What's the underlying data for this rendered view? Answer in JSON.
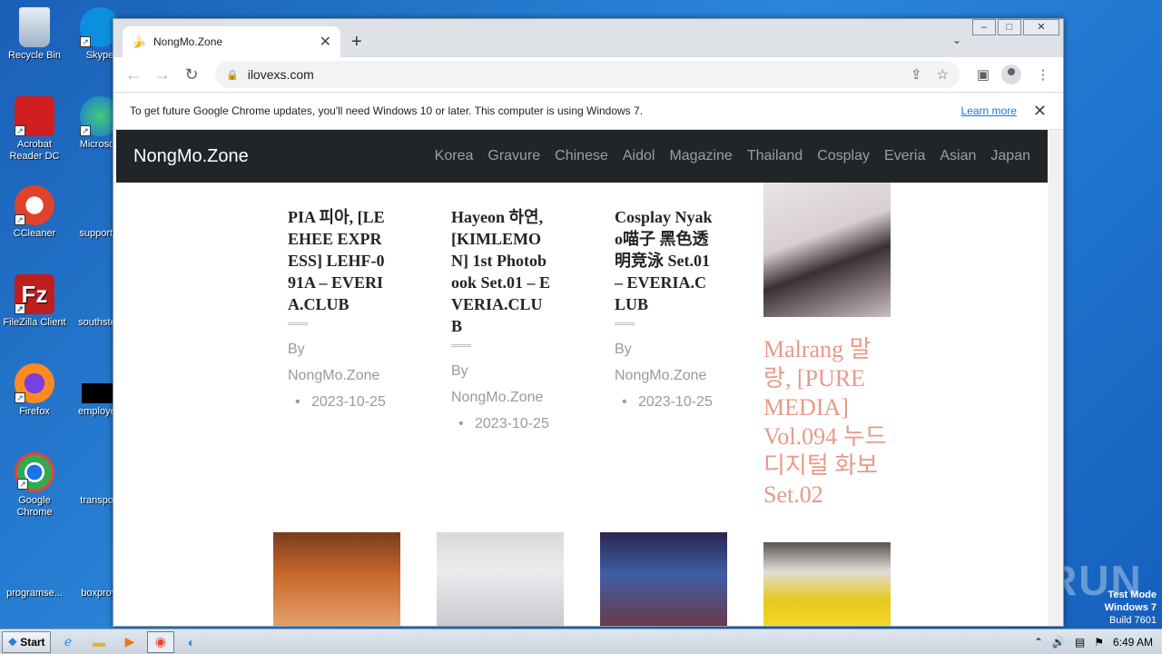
{
  "desktop": {
    "icons": [
      {
        "label": "Recycle Bin"
      },
      {
        "label": "Skype"
      },
      {
        "label": "Acrobat Reader DC"
      },
      {
        "label": "Microsoft"
      },
      {
        "label": "CCleaner"
      },
      {
        "label": "supportal"
      },
      {
        "label": "FileZilla Client"
      },
      {
        "label": "southstep"
      },
      {
        "label": "Firefox"
      },
      {
        "label": "employee"
      },
      {
        "label": "Google Chrome"
      },
      {
        "label": "transport"
      },
      {
        "label": "programse..."
      },
      {
        "label": "boxprovi"
      }
    ]
  },
  "browser": {
    "tab": {
      "title": "NongMo.Zone",
      "favicon": "banana-icon"
    },
    "url": "ilovexs.com",
    "infobar": {
      "message": "To get future Google Chrome updates, you'll need Windows 10 or later. This computer is using Windows 7.",
      "link": "Learn more"
    }
  },
  "site": {
    "brand": "NongMo.Zone",
    "nav": [
      "Korea",
      "Gravure",
      "Chinese",
      "Aidol",
      "Magazine",
      "Thailand",
      "Cosplay",
      "Everia",
      "Asian",
      "Japan"
    ],
    "posts": [
      {
        "title": "PIA 피아, [LEEHEE EXPRESS] LEHF-091A – EVERIA.CLUB",
        "by": "By",
        "author": "NongMo.Zone",
        "date": "2023-10-25"
      },
      {
        "title": "Hayeon 하연, [KIMLEMON] 1st Photobook Set.01 – EVERIA.CLUB",
        "by": "By",
        "author": "NongMo.Zone",
        "date": "2023-10-25"
      },
      {
        "title": "Cosplay Nyako喵子 黑色透明竞泳 Set.01 – EVERIA.CLUB",
        "by": "By",
        "author": "NongMo.Zone",
        "date": "2023-10-25"
      }
    ],
    "featured_title": "Malrang 말랑, [PURE MEDIA] Vol.094 누드 디지털 화보 Set.02"
  },
  "taskbar": {
    "start": "Start",
    "time": "6:49 AM"
  },
  "watermark": {
    "line1": "Test Mode",
    "line2": "Windows 7",
    "line3": "Build 7601",
    "brand": "ANY RUN"
  },
  "colors": {
    "navbar": "#212529",
    "featured_title": "#e89a86",
    "desktop": "#1f74cf"
  }
}
